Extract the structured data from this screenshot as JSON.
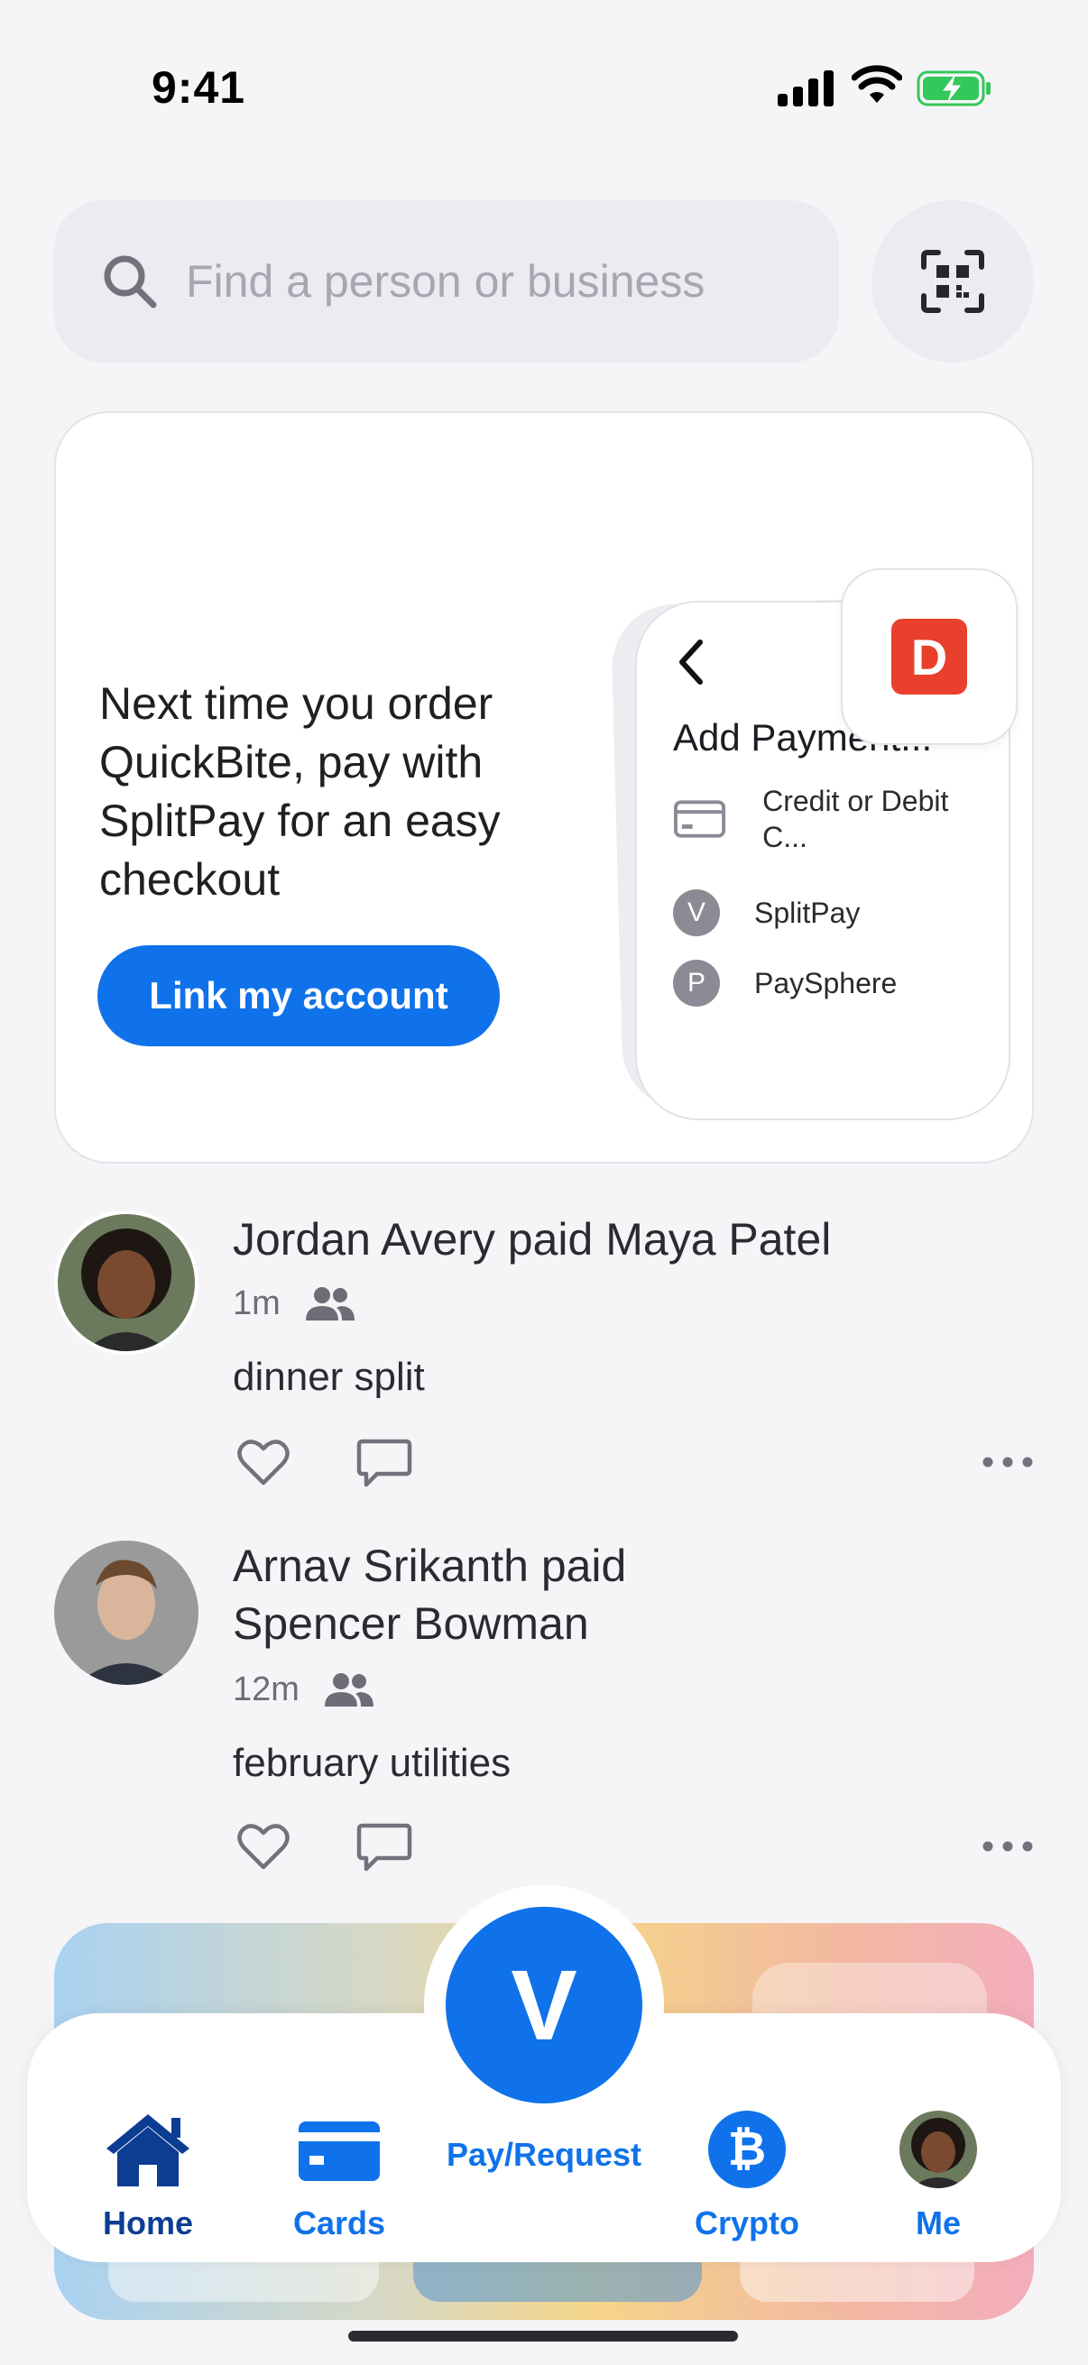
{
  "status_bar": {
    "time": "9:41"
  },
  "search": {
    "placeholder": "Find a person or business"
  },
  "promo": {
    "text": "Next time you order QuickBite, pay with SplitPay for an easy checkout",
    "button_label": "Link my account",
    "mock_sheet": {
      "title": "Add Payment...",
      "options": [
        {
          "icon": "credit-card-icon",
          "label": "Credit or Debit C..."
        },
        {
          "badge": "V",
          "label": "SplitPay"
        },
        {
          "badge": "P",
          "label": "PaySphere"
        }
      ]
    },
    "app_tile_letter": "D",
    "colors": {
      "button": "#0f72ea",
      "app_tile": "#e8402c"
    }
  },
  "feed": [
    {
      "title": "Jordan Avery paid Maya Patel",
      "time": "1m",
      "note": "dinner split"
    },
    {
      "title": "Arnav Srikanth paid Spencer Bowman",
      "time": "12m",
      "note": "february utilities"
    }
  ],
  "tab_bar": {
    "pay_fab_letter": "V",
    "tabs": [
      {
        "label": "Home",
        "icon": "home-icon"
      },
      {
        "label": "Cards",
        "icon": "card-icon"
      },
      {
        "label": "Pay/Request",
        "icon": "venmo-v-icon"
      },
      {
        "label": "Crypto",
        "icon": "bitcoin-icon"
      },
      {
        "label": "Me",
        "icon": "avatar"
      }
    ],
    "bitcoin_glyph": "₿",
    "colors": {
      "active": "#0d3d92",
      "accent": "#0f72ea"
    }
  }
}
